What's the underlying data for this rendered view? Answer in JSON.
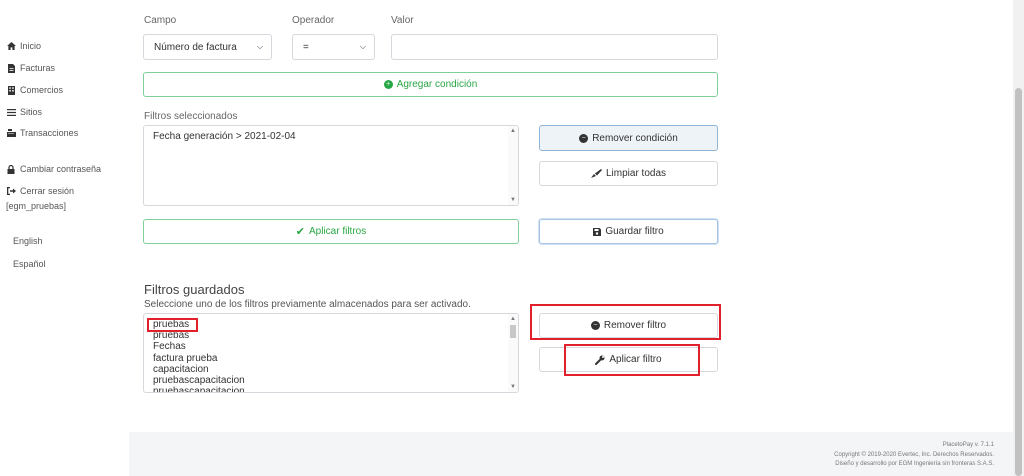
{
  "sidebar": {
    "items": [
      {
        "label": "Inicio",
        "icon": "home-icon"
      },
      {
        "label": "Facturas",
        "icon": "file-icon"
      },
      {
        "label": "Comercios",
        "icon": "building-icon"
      },
      {
        "label": "Sitios",
        "icon": "list-icon"
      },
      {
        "label": "Transacciones",
        "icon": "cash-register-icon"
      },
      {
        "label": "Cambiar contraseña",
        "icon": "lock-icon"
      },
      {
        "label": "Cerrar sesión",
        "icon": "sign-out-icon"
      }
    ],
    "username": "[egm_pruebas]",
    "languages": [
      "English",
      "Español"
    ]
  },
  "condition_form": {
    "field_label": "Campo",
    "operator_label": "Operador",
    "value_label": "Valor",
    "field_value": "Número de factura",
    "operator_value": "=",
    "value_value": "",
    "add_condition_label": "Agregar condición"
  },
  "selected_filters": {
    "label": "Filtros seleccionados",
    "items": [
      "Fecha generación > 2021-02-04"
    ],
    "remove_condition_label": "Remover condición",
    "clear_all_label": "Limpiar todas",
    "apply_filters_label": "Aplicar filtros",
    "save_filter_label": "Guardar filtro"
  },
  "saved_filters": {
    "title": "Filtros guardados",
    "description": "Seleccione uno de los filtros previamente almacenados para ser activado.",
    "items": [
      "pruebas",
      "pruebas",
      "Fechas",
      "factura prueba",
      "capacitacion",
      "pruebascapacitacion",
      "pruebascapacitacion"
    ],
    "remove_filter_label": "Remover filtro",
    "apply_filter_label": "Aplicar filtro"
  },
  "footer": {
    "version": "PlacetoPay v. 7.1.1",
    "copyright": "Copyright © 2019-2020 Evertec, Inc. Derechos Reservados.",
    "credits": "Diseño y desarrollo por EGM Ingeniería sin fronteras S.A.S."
  },
  "colors": {
    "accent_green": "#28a745",
    "highlight_red": "#e0202a",
    "focus_blue": "#8fb5d6"
  }
}
